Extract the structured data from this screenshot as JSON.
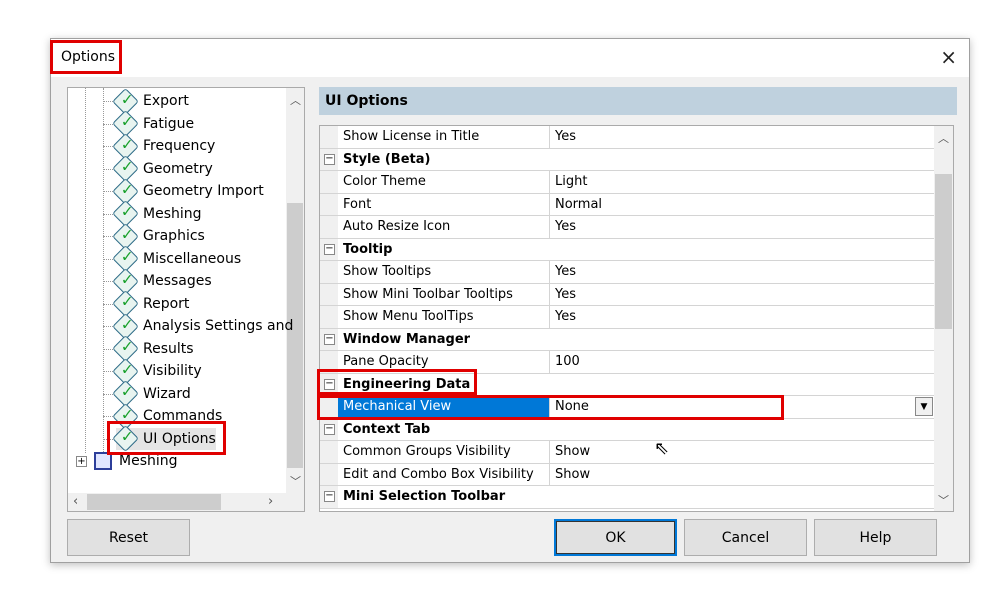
{
  "window": {
    "title": "Options",
    "close_icon": "×"
  },
  "tree": {
    "items": [
      "Export",
      "Fatigue",
      "Frequency",
      "Geometry",
      "Geometry Import",
      "Meshing",
      "Graphics",
      "Miscellaneous",
      "Messages",
      "Report",
      "Analysis Settings and",
      "Results",
      "Visibility",
      "Wizard",
      "Commands",
      "UI Options"
    ],
    "selected": "UI Options",
    "root_item": "Meshing"
  },
  "panel": {
    "header": "UI Options"
  },
  "grid": {
    "rows": [
      {
        "type": "prop",
        "name": "Show License in Title",
        "value": "Yes"
      },
      {
        "type": "cat",
        "name": "Style (Beta)"
      },
      {
        "type": "prop",
        "name": "Color Theme",
        "value": "Light"
      },
      {
        "type": "prop",
        "name": "Font",
        "value": "Normal"
      },
      {
        "type": "prop",
        "name": "Auto Resize Icon",
        "value": "Yes"
      },
      {
        "type": "cat",
        "name": "Tooltip"
      },
      {
        "type": "prop",
        "name": "Show Tooltips",
        "value": "Yes"
      },
      {
        "type": "prop",
        "name": "Show Mini Toolbar Tooltips",
        "value": "Yes"
      },
      {
        "type": "prop",
        "name": "Show Menu ToolTips",
        "value": "Yes"
      },
      {
        "type": "cat",
        "name": "Window Manager"
      },
      {
        "type": "prop",
        "name": "Pane Opacity",
        "value": "100"
      },
      {
        "type": "cat",
        "name": "Engineering Data"
      },
      {
        "type": "prop",
        "name": "Mechanical View",
        "value": "None",
        "selected": true
      },
      {
        "type": "cat",
        "name": "Context Tab"
      },
      {
        "type": "prop",
        "name": "Common Groups Visibility",
        "value": "Show"
      },
      {
        "type": "prop",
        "name": "Edit and Combo Box Visibility",
        "value": "Show"
      },
      {
        "type": "cat",
        "name": "Mini Selection Toolbar"
      }
    ]
  },
  "buttons": {
    "reset": "Reset",
    "ok": "OK",
    "cancel": "Cancel",
    "help": "Help"
  },
  "colors": {
    "highlight": "#e00000",
    "selection": "#0078d7",
    "header": "#bfd1de"
  }
}
